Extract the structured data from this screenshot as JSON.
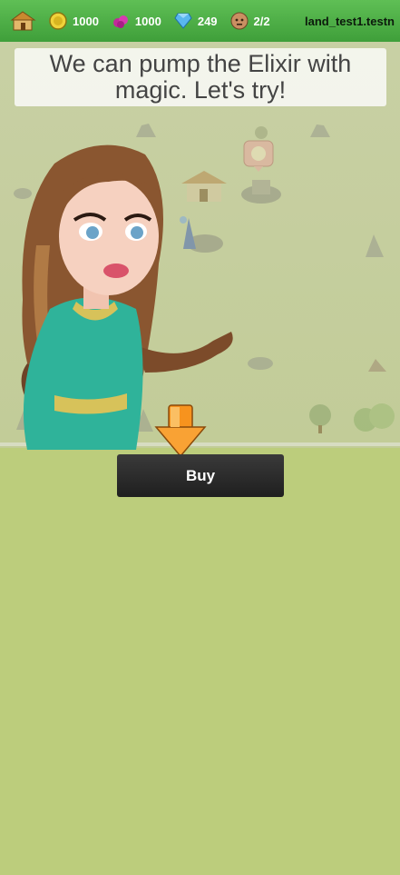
{
  "topbar": {
    "gold": "1000",
    "elixir": "1000",
    "gems": "249",
    "workers": "2/2",
    "player_name": "land_test1.testn"
  },
  "dialog": {
    "text": "We can pump the Elixir with magic. Let's try!"
  },
  "actions": {
    "buy_label": "Buy"
  },
  "colors": {
    "topbar": "#4caf45",
    "ground": "#bccd7c",
    "button": "#2a2a2a",
    "arrow": "#f7931e"
  },
  "icons": [
    "town-hall-icon",
    "gold-coin-icon",
    "elixir-icon",
    "gem-icon",
    "worker-icon",
    "down-arrow-icon"
  ]
}
